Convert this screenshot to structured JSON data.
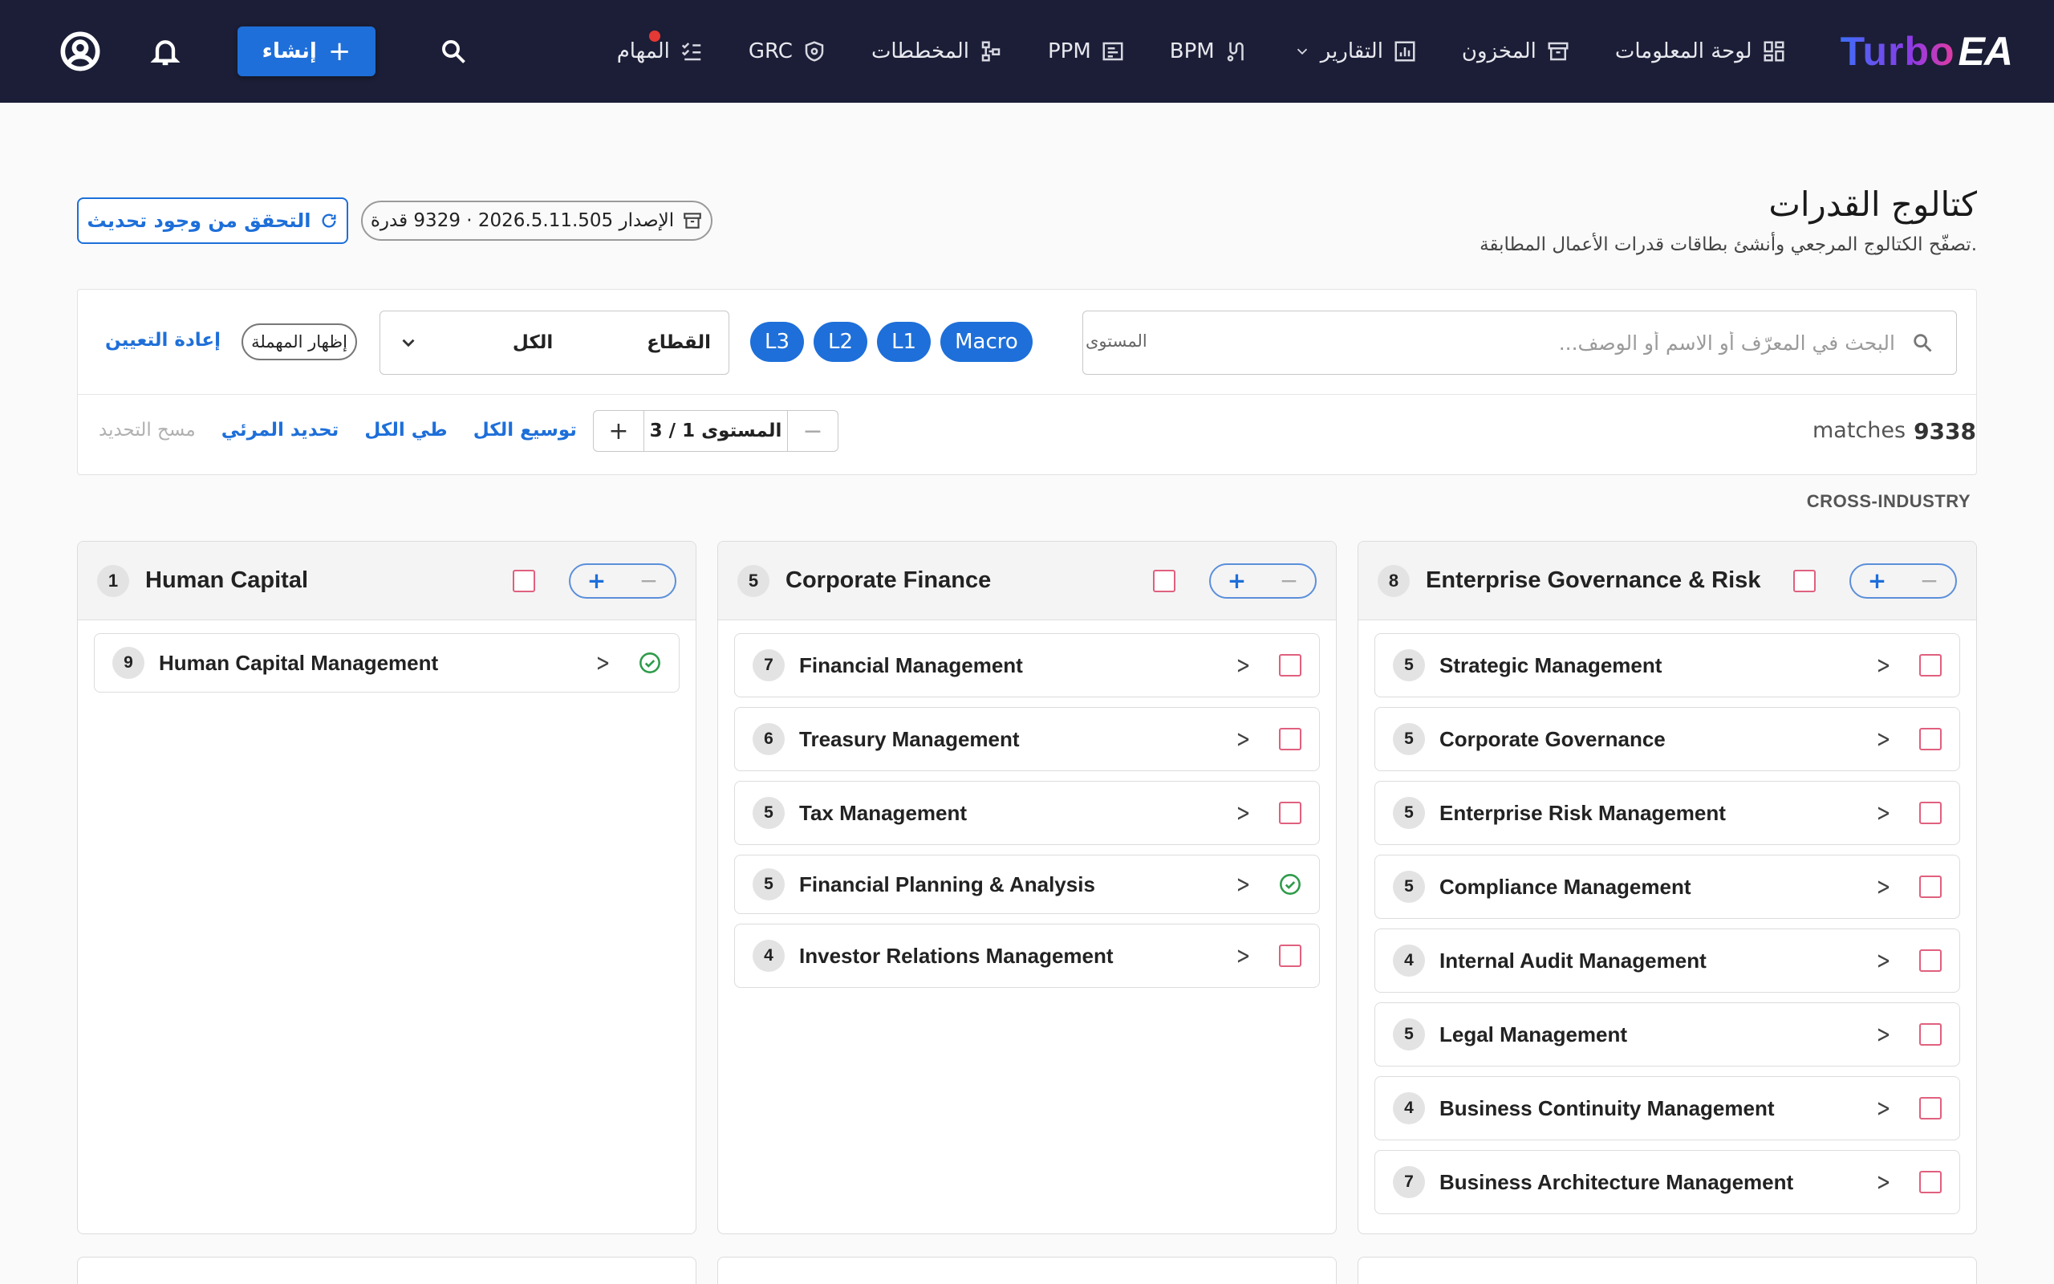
{
  "topbar": {
    "logo_text": "Turbo",
    "logo_ea": "EA",
    "nav": [
      {
        "label": "لوحة المعلومات",
        "icon": "dashboard-icon"
      },
      {
        "label": "المخزون",
        "icon": "archive-icon"
      },
      {
        "label": "التقارير",
        "icon": "chart-icon"
      },
      {
        "label": "BPM",
        "icon": "flow-icon"
      },
      {
        "label": "PPM",
        "icon": "project-icon"
      },
      {
        "label": "المخططات",
        "icon": "diagram-icon"
      },
      {
        "label": "GRC",
        "icon": "shield-icon"
      },
      {
        "label": "المهام",
        "icon": "tasks-icon"
      }
    ],
    "create_label": "إنشاء"
  },
  "header": {
    "title": "كتالوج القدرات",
    "subtitle": "تصفّح الكتالوج المرجعي وأنشئ بطاقات قدرات الأعمال المطابقة.",
    "version_text": "الإصدار 2026.5.11.505 · 9329 قدرة",
    "check_update_label": "التحقق من وجود تحديث"
  },
  "filters": {
    "search_placeholder": "البحث في المعرّف أو الاسم أو الوصف...",
    "level_label": "المستوى",
    "levels": [
      "Macro",
      "L1",
      "L2",
      "L3"
    ],
    "sector_label": "القطاع",
    "sector_value": "الكل",
    "show_deprecated_label": "إظهار المهملة",
    "reset_label": "إعادة التعيين",
    "matches_count": "9338",
    "matches_label": "matches",
    "level_stepper_text": "المستوى 1 / 3",
    "expand_all": "توسيع الكل",
    "collapse_all": "طي الكل",
    "select_visible": "تحديد المرئي",
    "clear_selection": "مسح التحديد"
  },
  "section_label": "CROSS-INDUSTRY",
  "columns": [
    {
      "count": "1",
      "title": "Human Capital",
      "items": [
        {
          "count": "9",
          "title": "Human Capital Management",
          "status": "done"
        }
      ]
    },
    {
      "count": "5",
      "title": "Corporate Finance",
      "items": [
        {
          "count": "7",
          "title": "Financial Management",
          "status": "box"
        },
        {
          "count": "6",
          "title": "Treasury Management",
          "status": "box"
        },
        {
          "count": "5",
          "title": "Tax Management",
          "status": "box"
        },
        {
          "count": "5",
          "title": "Financial Planning & Analysis",
          "status": "done"
        },
        {
          "count": "4",
          "title": "Investor Relations Management",
          "status": "box"
        }
      ]
    },
    {
      "count": "8",
      "title": "Enterprise Governance & Risk",
      "items": [
        {
          "count": "5",
          "title": "Strategic Management",
          "status": "box"
        },
        {
          "count": "5",
          "title": "Corporate Governance",
          "status": "box"
        },
        {
          "count": "5",
          "title": "Enterprise Risk Management",
          "status": "box"
        },
        {
          "count": "5",
          "title": "Compliance Management",
          "status": "box"
        },
        {
          "count": "4",
          "title": "Internal Audit Management",
          "status": "box"
        },
        {
          "count": "5",
          "title": "Legal Management",
          "status": "box"
        },
        {
          "count": "4",
          "title": "Business Continuity Management",
          "status": "box"
        },
        {
          "count": "7",
          "title": "Business Architecture Management",
          "status": "box"
        }
      ]
    }
  ],
  "colors": {
    "topbar_bg": "#1b1e36",
    "accent": "#1e6fd9",
    "checkbox_border": "#e0607e",
    "done_green": "#2e9b4a"
  }
}
